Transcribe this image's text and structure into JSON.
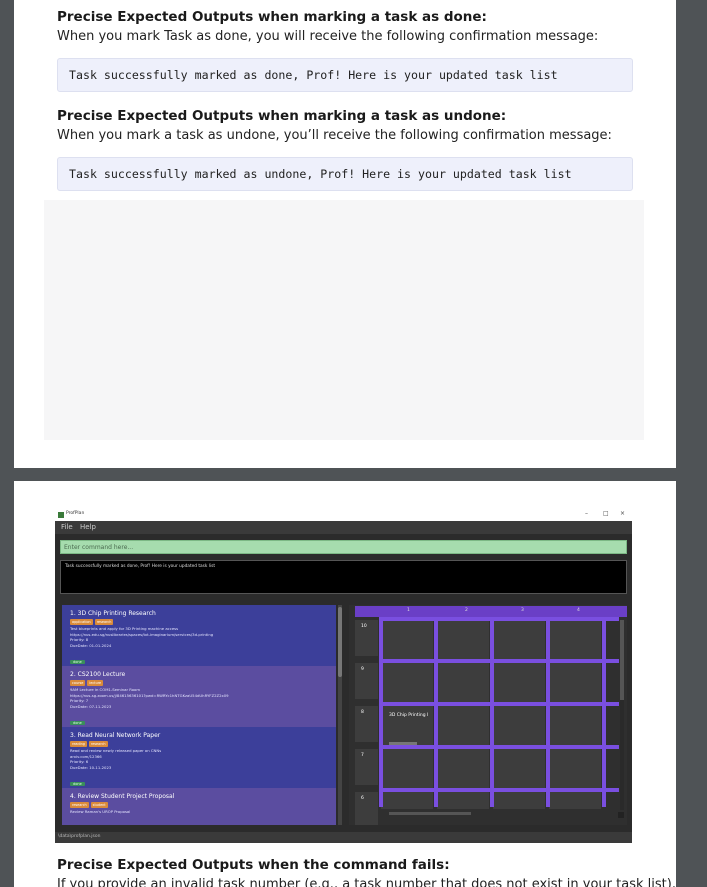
{
  "page1": {
    "section_done": {
      "heading": "Precise Expected Outputs when marking a task as done:",
      "text": "When you mark Task as done, you will receive the following confirmation message:",
      "code": "Task successfully marked as done, Prof! Here is your updated task list"
    },
    "section_undone": {
      "heading": "Precise Expected Outputs when marking a task as undone:",
      "text": "When you mark a task as undone, you’ll receive the following confirmation message:",
      "code": "Task successfully marked as undone, Prof! Here is your updated task list"
    }
  },
  "app": {
    "window_title": "ProfPlan",
    "window_controls": [
      "–",
      "□",
      "×"
    ],
    "menu": [
      "File",
      "Help"
    ],
    "command_placeholder": "Enter command here...",
    "result_message": "Task successfully marked as done, Prof! Here is your updated task list",
    "tasks": [
      {
        "title": "1.  3D Chip Printing Research",
        "tags": [
          "application",
          "research"
        ],
        "lines": [
          "Test blueprints and apply for 3D Printing machine access",
          "https://nus.edu.sg/nuslibraries/spaces/txt-imaginarium/services/3d-printing",
          "Priority: 8",
          "DueDate: 01-01-2024"
        ],
        "status": "done"
      },
      {
        "title": "2.  CS2100 Lecture",
        "tags": [
          "course",
          "lecture"
        ],
        "lines": [
          "9AM Lecture in COM1-Seminar Room",
          "https://nus-sg.zoom.us/j/84615636101?pwd=RWRYc1hNTGKzaU54dUhRYFZ2Z2x09",
          "Priority: 7",
          "DueDate: 07-11-2023"
        ],
        "status": "done"
      },
      {
        "title": "3.  Read Neural Network Paper",
        "tags": [
          "reading",
          "research"
        ],
        "lines": [
          "Read and review newly released paper on CNNs",
          "arxiv.com/12366",
          "Priority: 6",
          "DueDate: 10-11-2023"
        ],
        "status": "done"
      },
      {
        "title": "4.  Review Student Project Proposal",
        "tags": [
          "research",
          "student"
        ],
        "lines": [
          "Review Raman's UROP Proposal"
        ],
        "status": ""
      }
    ],
    "calendar": {
      "days": [
        "1",
        "2",
        "3",
        "4"
      ],
      "hours": [
        "10",
        "9",
        "8",
        "7",
        "6"
      ],
      "event": "3D Chip Printing I"
    },
    "status_path": "\\data\\profplan.json"
  },
  "page2": {
    "section_fail": {
      "heading": "Precise Expected Outputs when the command fails:",
      "text": "If you provide an invalid task number (e.g., a task number that does not exist in your task list), you"
    }
  }
}
